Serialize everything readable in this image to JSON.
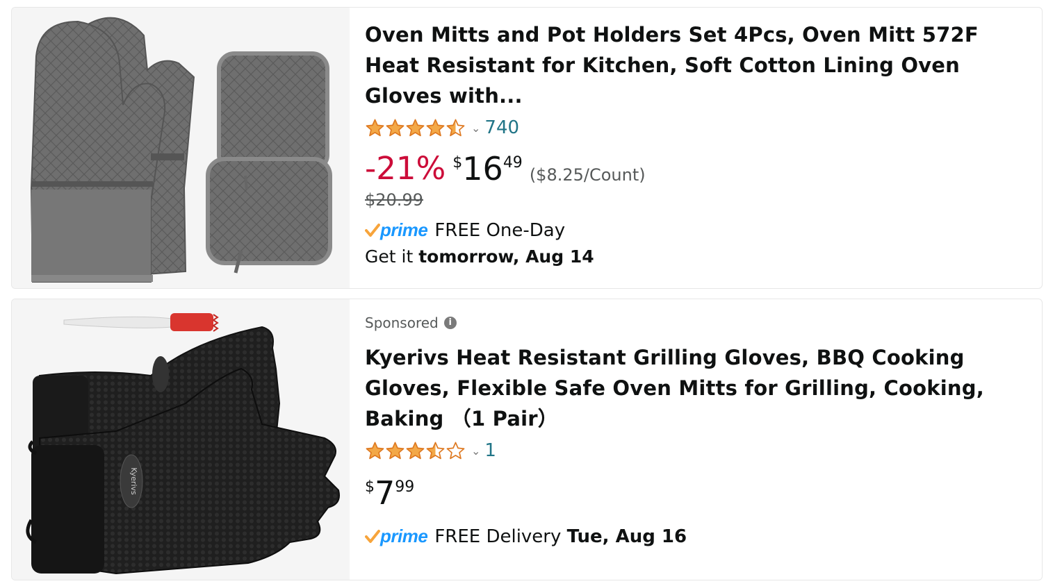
{
  "results": [
    {
      "title": "Oven Mitts and Pot Holders Set 4Pcs, Oven Mitt 572F Heat Resistant for Kitchen, Soft Cotton Lining Oven Gloves with...",
      "rating": 4.5,
      "rating_count": "740",
      "discount": "-21%",
      "price_symbol": "$",
      "price_whole": "16",
      "price_fraction": "49",
      "unit_price": "($8.25/Count)",
      "list_price": "$20.99",
      "prime_label": "prime",
      "delivery_label": "FREE One-Day",
      "get_it_prefix": "Get it ",
      "get_it_date": "tomorrow, Aug 14",
      "image_icon": "oven-mitts-image"
    },
    {
      "sponsored": "Sponsored",
      "title": "Kyerivs Heat Resistant Grilling Gloves, BBQ Cooking Gloves, Flexible Safe Oven Mitts for Grilling, Cooking, Baking （1 Pair）",
      "rating": 3.5,
      "rating_count": "1",
      "price_symbol": "$",
      "price_whole": "7",
      "price_fraction": "99",
      "prime_label": "prime",
      "delivery_label": "FREE Delivery ",
      "delivery_date": "Tue, Aug 16",
      "glove_brand_text": "Kyerivs",
      "image_icon": "grilling-gloves-image"
    }
  ],
  "colors": {
    "star": "#f3a847",
    "discount": "#cc0c39",
    "link": "#217587",
    "prime": "#1a98ff",
    "check": "#f7a43b"
  }
}
